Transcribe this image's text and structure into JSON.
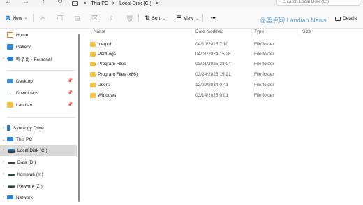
{
  "address_bar": {
    "breadcrumbs": [
      "This PC",
      "Local Disk (C:)"
    ],
    "separator": ">",
    "search_placeholder": "Search Local Disk (C:)"
  },
  "toolbar": {
    "new_label": "New",
    "sort_label": "Sort",
    "view_label": "View",
    "more_label": "•••",
    "details_label": "Details",
    "watermark": "@蓝点网 Landian.News"
  },
  "sidebar": {
    "quick": [
      {
        "label": "Home",
        "icon": "home-icon"
      },
      {
        "label": "Gallery",
        "icon": "gallery-icon"
      },
      {
        "label": "鸭子哥 - Personal",
        "icon": "onedrive-icon"
      }
    ],
    "pinned": [
      {
        "label": "Desktop",
        "icon": "desktop-icon"
      },
      {
        "label": "Downloads",
        "icon": "download-icon"
      },
      {
        "label": "Landian",
        "icon": "folder-icon"
      }
    ],
    "tree": [
      {
        "label": "Synology Drive",
        "icon": "synology-icon"
      },
      {
        "label": "This PC",
        "icon": "computer-icon"
      },
      {
        "label": "Local Disk (C:)",
        "icon": "local-disk-icon",
        "selected": true
      },
      {
        "label": "Data (D:)",
        "icon": "disk-icon"
      },
      {
        "label": "homelab (Y:)",
        "icon": "network-drive-icon"
      },
      {
        "label": "Network (Z:)",
        "icon": "network-drive-icon"
      },
      {
        "label": "Network",
        "icon": "network-icon"
      }
    ]
  },
  "file_list": {
    "columns": [
      "Name",
      "Date modified",
      "Type",
      "Size"
    ],
    "rows": [
      {
        "name": "inetpub",
        "date": "04/10/2025 7:10",
        "type": "File folder",
        "size": ""
      },
      {
        "name": "PerfLogs",
        "date": "04/01/2024 15:26",
        "type": "File folder",
        "size": ""
      },
      {
        "name": "Program Files",
        "date": "03/01/2025 23:04",
        "type": "File folder",
        "size": ""
      },
      {
        "name": "Program Files (x86)",
        "date": "03/24/2025 15:21",
        "type": "File folder",
        "size": ""
      },
      {
        "name": "Users",
        "date": "12/20/2024 0:41",
        "type": "File folder",
        "size": ""
      },
      {
        "name": "Windows",
        "date": "03/14/2025 0:01",
        "type": "File folder",
        "size": ""
      }
    ]
  },
  "colors": {
    "accent": "#0067c0",
    "folder": "#f5c343",
    "selection": "#d9d9d9"
  }
}
